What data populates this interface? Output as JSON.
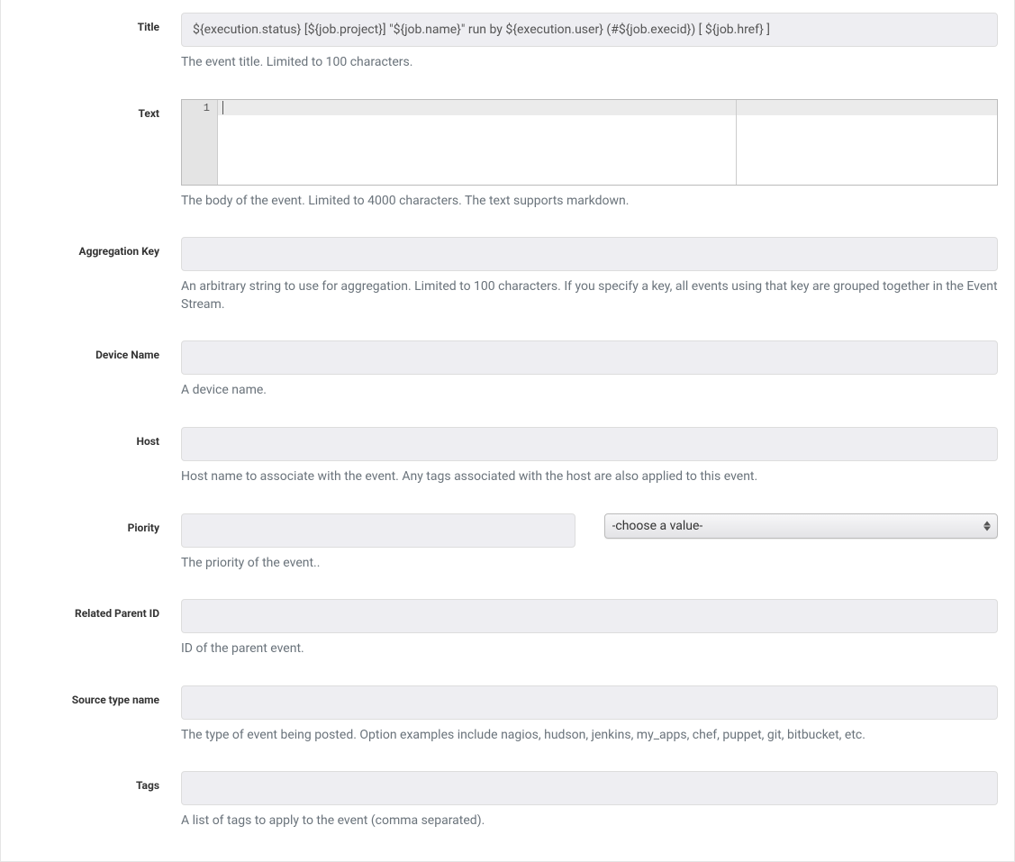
{
  "fields": {
    "title": {
      "label": "Title",
      "value": "${execution.status} [${job.project}] \"${job.name}\" run by ${execution.user} (#${job.execid}) [ ${job.href} ]",
      "help": "The event title. Limited to 100 characters."
    },
    "text": {
      "label": "Text",
      "line_number": "1",
      "help": "The body of the event. Limited to 4000 characters. The text supports markdown."
    },
    "aggregation_key": {
      "label": "Aggregation Key",
      "value": "",
      "help": "An arbitrary string to use for aggregation. Limited to 100 characters. If you specify a key, all events using that key are grouped together in the Event Stream."
    },
    "device_name": {
      "label": "Device Name",
      "value": "",
      "help": "A device name."
    },
    "host": {
      "label": "Host",
      "value": "",
      "help": "Host name to associate with the event. Any tags associated with the host are also applied to this event."
    },
    "priority": {
      "label": "Piority",
      "value": "",
      "select_placeholder": "-choose a value-",
      "help": "The priority of the event.."
    },
    "related_parent_id": {
      "label": "Related Parent ID",
      "value": "",
      "help": "ID of the parent event."
    },
    "source_type_name": {
      "label": "Source type name",
      "value": "",
      "help": "The type of event being posted. Option examples include nagios, hudson, jenkins, my_apps, chef, puppet, git, bitbucket, etc."
    },
    "tags": {
      "label": "Tags",
      "value": "",
      "help": "A list of tags to apply to the event (comma separated)."
    }
  }
}
